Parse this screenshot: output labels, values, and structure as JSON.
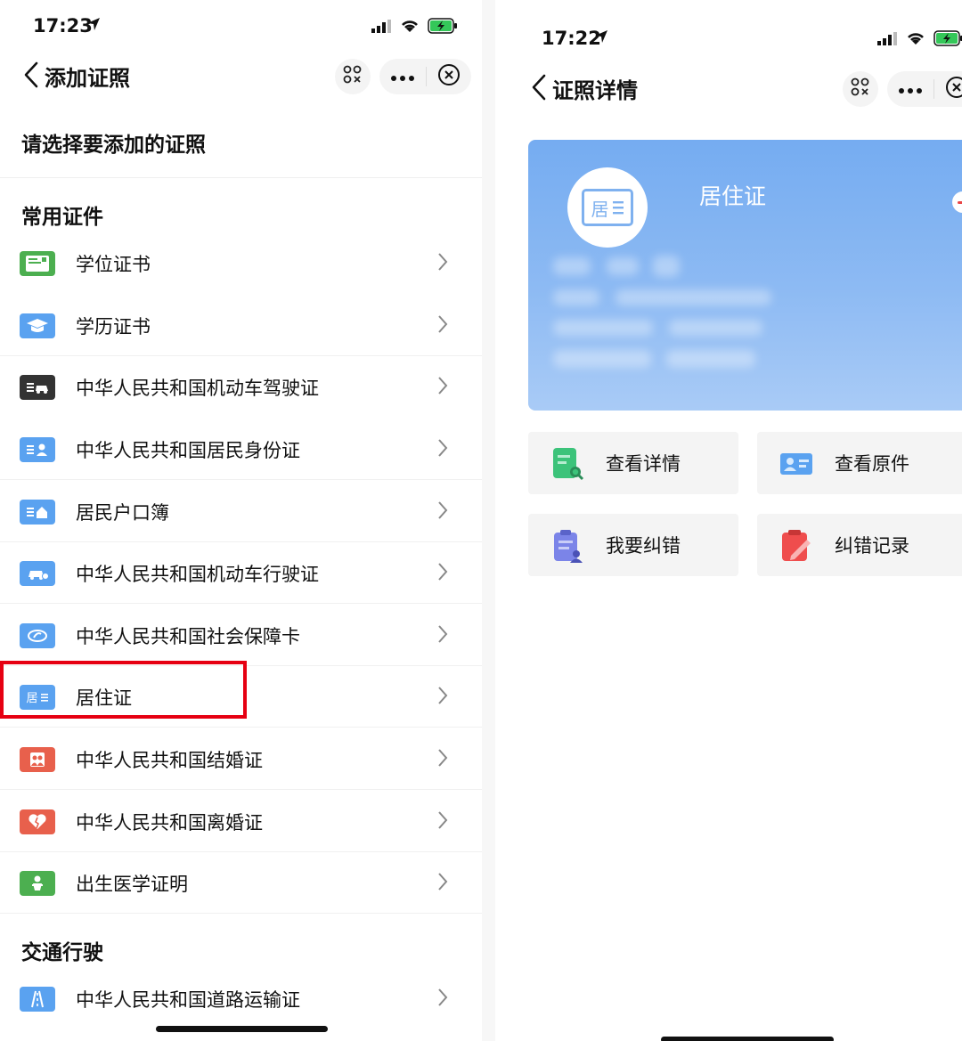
{
  "left": {
    "status": {
      "time": "17:23"
    },
    "nav": {
      "title": "添加证照"
    },
    "heading": "请选择要添加的证照",
    "sections": [
      {
        "title": "常用证件",
        "items": [
          {
            "label": "学位证书",
            "icon": "degree-certificate-icon",
            "color": "#4caf50"
          },
          {
            "label": "学历证书",
            "icon": "graduation-cap-icon",
            "color": "#5aa2f0"
          },
          {
            "label": "中华人民共和国机动车驾驶证",
            "icon": "driver-license-icon",
            "color": "#333333"
          },
          {
            "label": "中华人民共和国居民身份证",
            "icon": "id-card-icon",
            "color": "#5aa2f0"
          },
          {
            "label": "居民户口簿",
            "icon": "household-register-icon",
            "color": "#5aa2f0"
          },
          {
            "label": "中华人民共和国机动车行驶证",
            "icon": "vehicle-license-icon",
            "color": "#5aa2f0"
          },
          {
            "label": "中华人民共和国社会保障卡",
            "icon": "social-security-card-icon",
            "color": "#5aa2f0"
          },
          {
            "label": "居住证",
            "icon": "residence-permit-icon",
            "color": "#5aa2f0",
            "icon_text": "居"
          },
          {
            "label": "中华人民共和国结婚证",
            "icon": "marriage-certificate-icon",
            "color": "#e8604c"
          },
          {
            "label": "中华人民共和国离婚证",
            "icon": "divorce-certificate-icon",
            "color": "#e8604c"
          },
          {
            "label": "出生医学证明",
            "icon": "birth-certificate-icon",
            "color": "#4caf50"
          }
        ]
      },
      {
        "title": "交通行驶",
        "items": [
          {
            "label": "中华人民共和国道路运输证",
            "icon": "road-transport-icon",
            "color": "#5aa2f0"
          }
        ]
      }
    ]
  },
  "right": {
    "status": {
      "time": "17:22"
    },
    "nav": {
      "title": "证照详情"
    },
    "card": {
      "title": "居住证",
      "avatar_text": "居",
      "color": "#75acf1"
    },
    "actions": [
      {
        "label": "查看详情",
        "icon": "view-details-icon",
        "color": "#3cc37a"
      },
      {
        "label": "查看原件",
        "icon": "view-original-icon",
        "color": "#5aa2f0"
      },
      {
        "label": "我要纠错",
        "icon": "report-error-icon",
        "color": "#7b84e8"
      },
      {
        "label": "纠错记录",
        "icon": "error-record-icon",
        "color": "#ef4d4d"
      }
    ]
  }
}
